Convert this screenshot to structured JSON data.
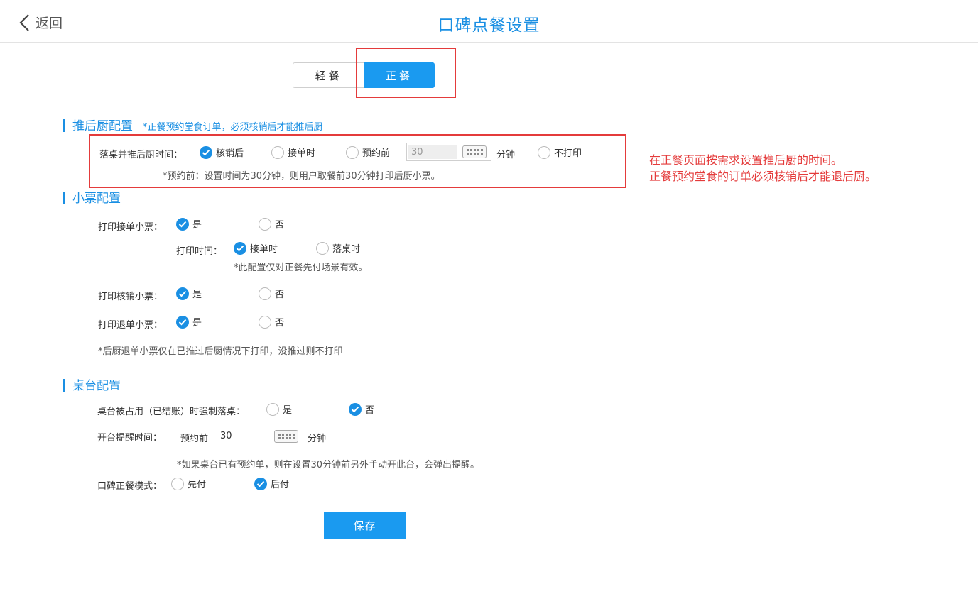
{
  "header": {
    "back_label": "返回",
    "title": "口碑点餐设置"
  },
  "tabs": {
    "light": "轻餐",
    "formal": "正餐",
    "active": "formal"
  },
  "kitchen": {
    "title": "推后厨配置",
    "note": "*正餐预约堂食订单，必须核销后才能推后厨",
    "row_label": "落桌并推后厨时间：",
    "opt_verify": "核销后",
    "opt_accept": "接单时",
    "opt_reserve": "预约前",
    "reserve_value": "30",
    "unit": "分钟",
    "opt_noprint": "不打印",
    "hint": "*预约前：设置时间为30分钟，则用户取餐前30分钟打印后厨小票。"
  },
  "annotation": {
    "line1": "在正餐页面按需求设置推后厨的时间。",
    "line2": "正餐预约堂食的订单必须核销后才能退后厨。"
  },
  "receipt": {
    "title": "小票配置",
    "accept_label": "打印接单小票：",
    "yes": "是",
    "no": "否",
    "print_time_label": "打印时间：",
    "time_accept": "接单时",
    "time_seat": "落桌时",
    "time_note": "*此配置仅对正餐先付场景有效。",
    "verify_label": "打印核销小票：",
    "refund_label": "打印退单小票：",
    "refund_note": "*后厨退单小票仅在已推过后厨情况下打印，没推过则不打印"
  },
  "table": {
    "title": "桌台配置",
    "occupied_label": "桌台被占用（已结账）时强制落桌：",
    "yes": "是",
    "no": "否",
    "remind_label": "开台提醒时间：",
    "remind_prefix": "预约前",
    "remind_value": "30",
    "remind_unit": "分钟",
    "remind_note": "*如果桌台已有预约单，则在设置30分钟前另外手动开此台，会弹出提醒。",
    "mode_label": "口碑正餐模式：",
    "mode_prepay": "先付",
    "mode_postpay": "后付"
  },
  "save_label": "保存",
  "colors": {
    "accent": "#1a8fe3",
    "button": "#1a9af0",
    "annotation": "#e43b3b"
  }
}
